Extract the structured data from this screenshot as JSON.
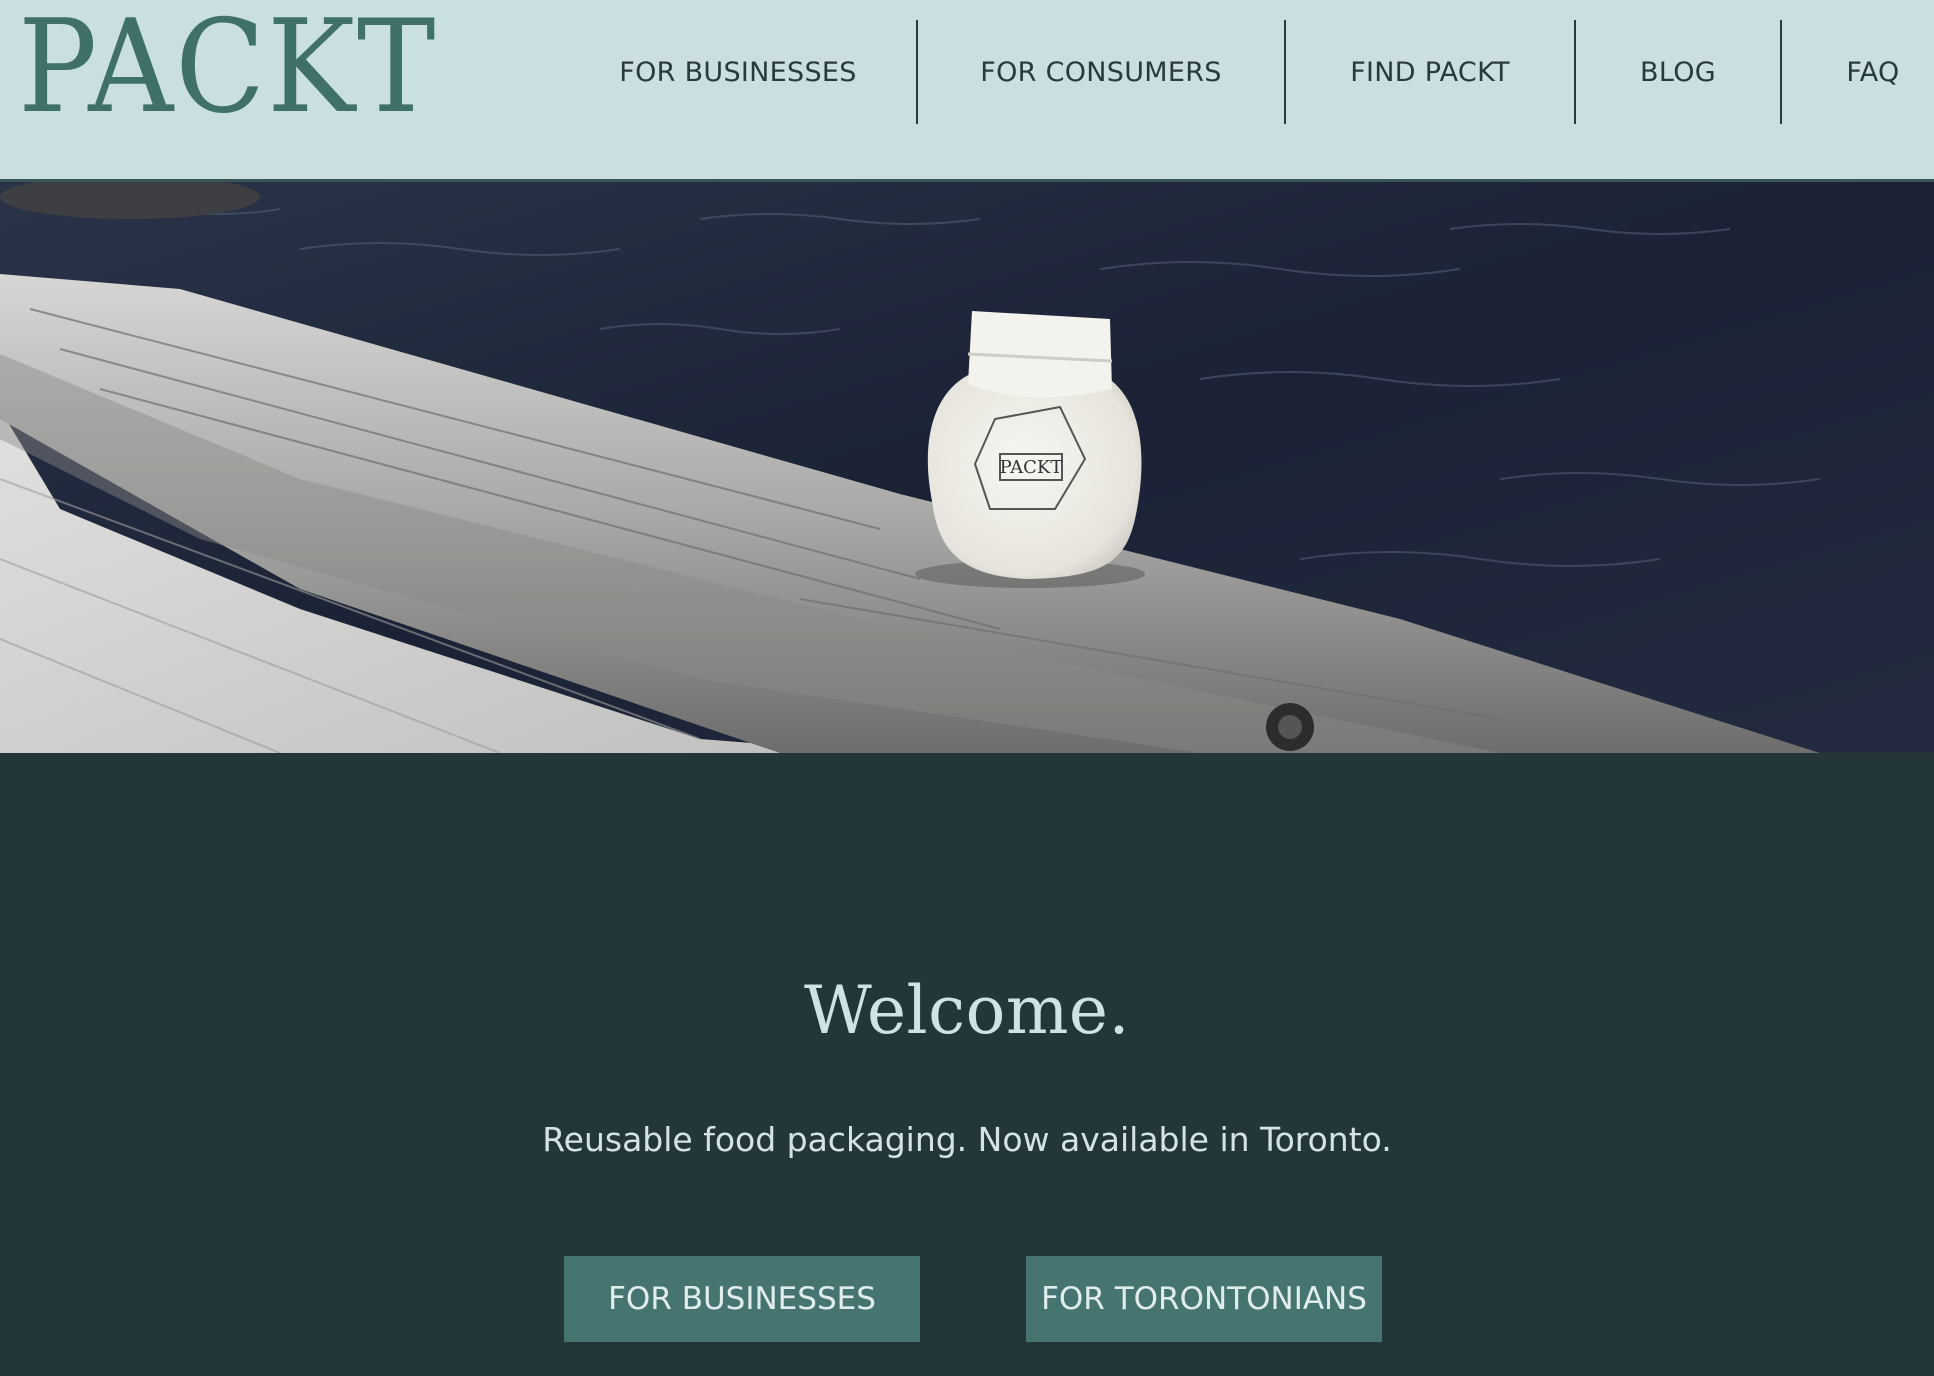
{
  "header": {
    "logo": "PACKT",
    "nav": [
      {
        "label": "FOR BUSINESSES"
      },
      {
        "label": "FOR CONSUMERS"
      },
      {
        "label": "FIND PACKT"
      },
      {
        "label": "BLOG"
      },
      {
        "label": "FAQ"
      }
    ]
  },
  "hero": {
    "image_subject": "white reusable PACKT pouch on a weathered log beside dark water",
    "pouch_brand": "PACKT"
  },
  "main": {
    "heading": "Welcome.",
    "subtitle": "Reusable food packaging. Now available in Toronto.",
    "buttons": [
      {
        "label": "FOR BUSINESSES"
      },
      {
        "label": "FOR TORONTONIANS"
      }
    ]
  },
  "colors": {
    "header_bg": "#c9dfe0",
    "brand": "#3f7069",
    "section_bg": "#233739",
    "button_bg": "#467571"
  }
}
